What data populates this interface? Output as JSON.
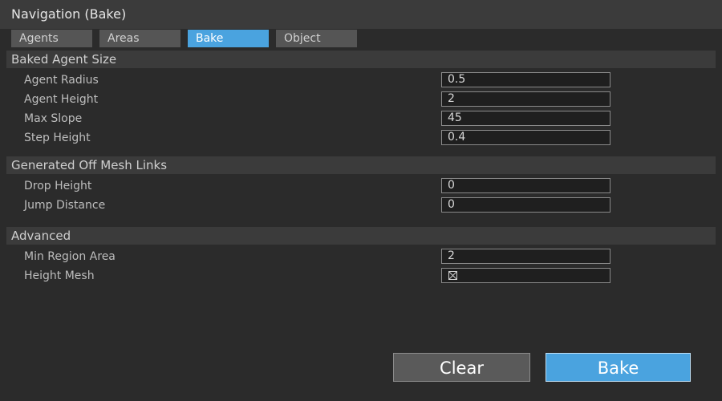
{
  "window": {
    "title": "Navigation (Bake)"
  },
  "tabs": [
    {
      "label": "Agents"
    },
    {
      "label": "Areas"
    },
    {
      "label": "Bake"
    },
    {
      "label": "Object"
    }
  ],
  "active_tab": "Bake",
  "sections": {
    "baked_agent_size": {
      "title": "Baked Agent Size",
      "agent_radius": {
        "label": "Agent Radius",
        "value": "0.5"
      },
      "agent_height": {
        "label": "Agent Height",
        "value": "2"
      },
      "max_slope": {
        "label": "Max Slope",
        "value": "45"
      },
      "step_height": {
        "label": "Step Height",
        "value": "0.4"
      }
    },
    "off_mesh_links": {
      "title": "Generated Off Mesh Links",
      "drop_height": {
        "label": "Drop Height",
        "value": "0"
      },
      "jump_distance": {
        "label": "Jump Distance",
        "value": "0"
      }
    },
    "advanced": {
      "title": "Advanced",
      "min_region_area": {
        "label": "Min Region Area",
        "value": "2"
      },
      "height_mesh": {
        "label": "Height Mesh",
        "checked": true
      }
    }
  },
  "buttons": {
    "clear": "Clear",
    "bake": "Bake"
  },
  "colors": {
    "accent": "#4aa3df",
    "background": "#2b2b2b",
    "header": "#3b3b3b"
  }
}
